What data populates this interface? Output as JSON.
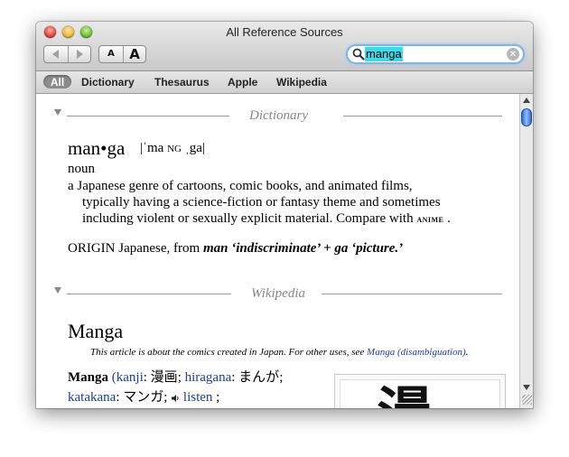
{
  "window": {
    "title": "All Reference Sources"
  },
  "toolbar": {
    "font_small_label": "A",
    "font_large_label": "A",
    "search_value": "manga",
    "clear_symbol": "×"
  },
  "filters": [
    {
      "label": "All",
      "selected": true
    },
    {
      "label": "Dictionary"
    },
    {
      "label": "Thesaurus"
    },
    {
      "label": "Apple"
    },
    {
      "label": "Wikipedia"
    }
  ],
  "dictionary": {
    "section_label": "Dictionary",
    "headword": "man•ga",
    "pron_open": "|ˈma",
    "pron_ng": "NG",
    "pron_close": "ˌga|",
    "part_of_speech": "noun",
    "def_line1": "a Japanese genre of cartoons, comic books, and animated films,",
    "def_line2": "typically having a science-fiction or fantasy theme and sometimes",
    "def_line3_pre": "including violent or sexually explicit material. Compare with",
    "def_xref": "anime",
    "def_line3_post": ".",
    "origin_label": "ORIGIN",
    "origin_text": "Japanese, from",
    "origin_bold": "man ‘indiscriminate’ + ga ‘picture.’"
  },
  "wikipedia": {
    "section_label": "Wikipedia",
    "title": "Manga",
    "hatnote_pre": "This article is about the comics created in Japan. For other uses, see",
    "hatnote_link": "Manga (disambiguation)",
    "hatnote_post": ".",
    "term": "Manga",
    "kanji_link": "kanji",
    "kanji_value": "漫画",
    "hiragana_link": "hiragana",
    "hiragana_value": "まんが",
    "katakana_link": "katakana",
    "katakana_value": "マンガ",
    "listen_link": "listen",
    "image_glyph": "漫"
  },
  "colors": {
    "link": "#1a3fa0",
    "search_highlight": "#3fd9e8",
    "accent": "#2d6cd2"
  },
  "icons": [
    "back-arrow-icon",
    "forward-arrow-icon",
    "search-icon",
    "clear-icon",
    "disclosure-triangle-icon",
    "speaker-icon"
  ]
}
